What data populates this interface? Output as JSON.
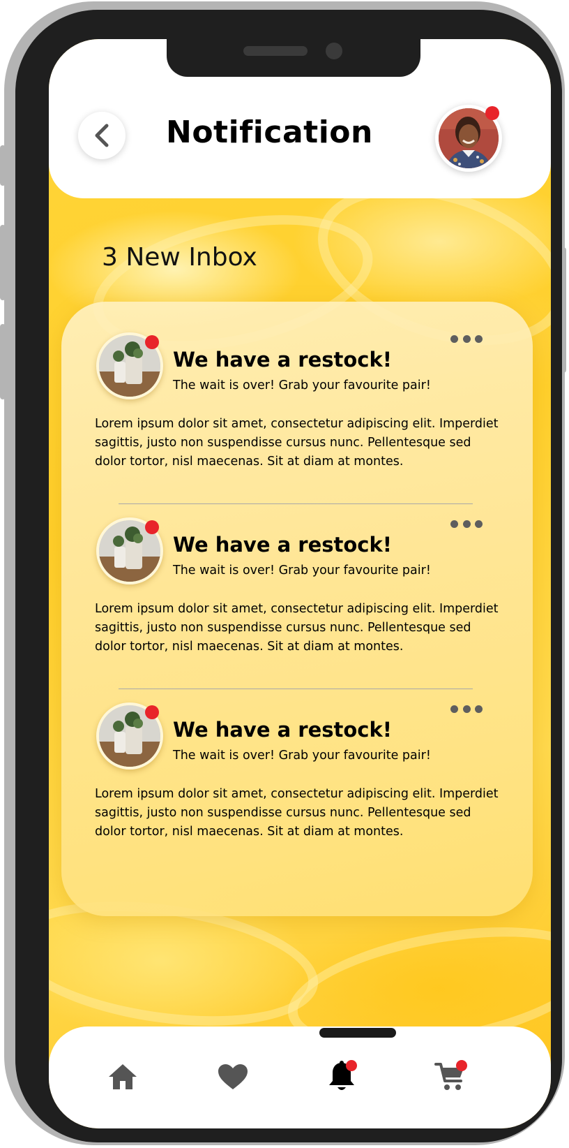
{
  "header": {
    "title": "Notification",
    "back_icon": "chevron-left-icon",
    "avatar_has_notification": true
  },
  "inbox": {
    "count_label": "3 New Inbox"
  },
  "notifications": [
    {
      "title": "We have a restock!",
      "subtitle": "The wait is over! Grab your favourite pair!",
      "body": "Lorem ipsum dolor sit amet, consectetur adipiscing elit. Imperdiet sagittis, justo non suspendisse cursus nunc. Pellentesque sed dolor tortor, nisl maecenas. Sit at diam at montes.",
      "unread": true
    },
    {
      "title": "We have a restock!",
      "subtitle": "The wait is over! Grab your favourite pair!",
      "body": "Lorem ipsum dolor sit amet, consectetur adipiscing elit. Imperdiet sagittis, justo non suspendisse cursus nunc. Pellentesque sed dolor tortor, nisl maecenas. Sit at diam at montes.",
      "unread": true
    },
    {
      "title": "We have a restock!",
      "subtitle": "The wait is over! Grab your favourite pair!",
      "body": "Lorem ipsum dolor sit amet, consectetur adipiscing elit. Imperdiet sagittis, justo non suspendisse cursus nunc. Pellentesque sed dolor tortor, nisl maecenas. Sit at diam at montes.",
      "unread": true
    }
  ],
  "bottom_nav": {
    "items": [
      {
        "icon": "home-icon",
        "active": false,
        "badge": false
      },
      {
        "icon": "heart-icon",
        "active": false,
        "badge": false
      },
      {
        "icon": "bell-icon",
        "active": true,
        "badge": true
      },
      {
        "icon": "cart-icon",
        "active": false,
        "badge": true
      }
    ]
  },
  "colors": {
    "badge": "#e8242a",
    "background_accent": "#ffd53a",
    "icon_inactive": "#555555",
    "icon_active": "#000000"
  }
}
